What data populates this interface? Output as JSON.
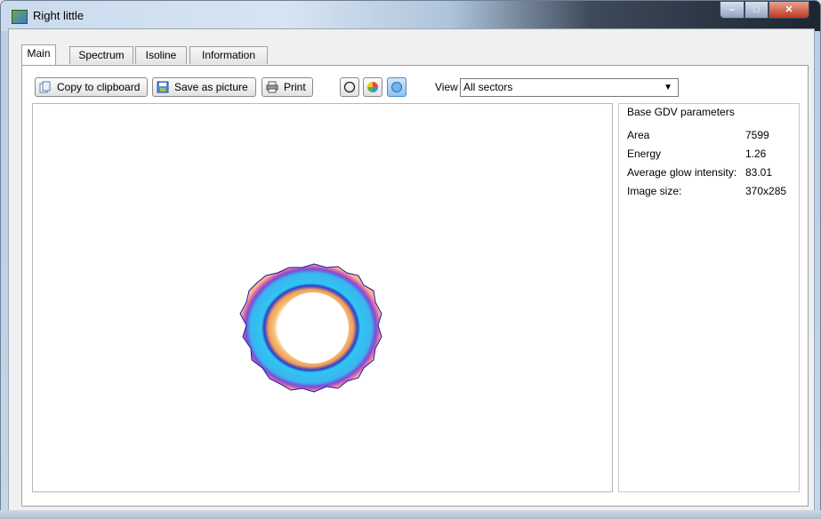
{
  "window": {
    "title": "Right little",
    "controls": {
      "minimize": "–",
      "maximize": "□",
      "close": "✕"
    }
  },
  "tabs": [
    {
      "label": "Main",
      "active": true
    },
    {
      "label": "Spectrum",
      "active": false
    },
    {
      "label": "Isoline",
      "active": false
    },
    {
      "label": "Information",
      "active": false
    }
  ],
  "toolbar": {
    "copy_label": "Copy to clipboard",
    "save_label": "Save as picture",
    "print_label": "Print",
    "view_label": "View",
    "view_selected": "All sectors",
    "icons": [
      "copy-icon",
      "save-picture-icon",
      "printer-icon",
      "circle-outline-icon",
      "color-pie-icon",
      "blue-shape-icon"
    ]
  },
  "params": {
    "title": "Base GDV parameters",
    "rows": [
      {
        "label": "Area",
        "value": "7599"
      },
      {
        "label": "Energy",
        "value": "1.26"
      },
      {
        "label": "Average glow intensity:",
        "value": "83.01"
      },
      {
        "label": "Image size:",
        "value": "370x285"
      }
    ]
  },
  "colors": {
    "glow_outer": "#7b4cd8",
    "glow_cyan": "#2ec6f2",
    "glow_orange": "#f2a05a",
    "glow_outline": "#1a1aa8"
  }
}
